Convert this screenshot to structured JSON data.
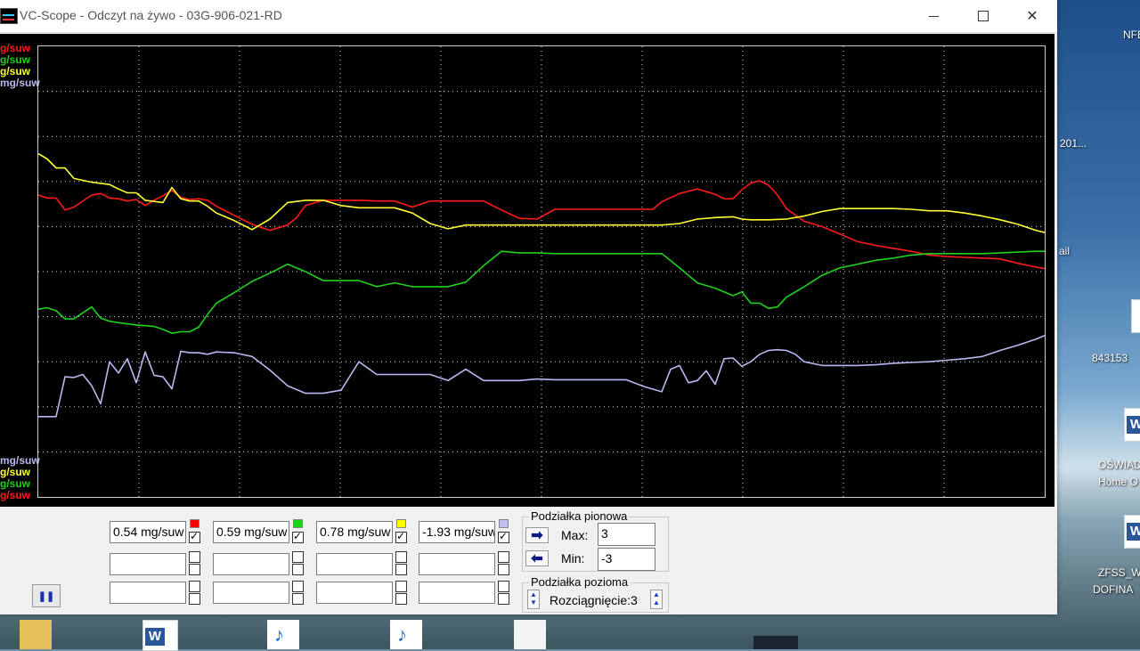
{
  "window": {
    "title": "VC-Scope  -  Odczyt na żywo  -  03G-906-021-RD"
  },
  "desktop": {
    "labels": {
      "nfe": "NFE",
      "d201": "201...",
      "ail": "ail",
      "num": "843153",
      "oswia": "OŚWIAD",
      "homeo": "Home O",
      "zfss": "ZFSS_W",
      "dofin": "DOFINA"
    }
  },
  "scope": {
    "top_labels": [
      "g/suw",
      "g/suw",
      "g/suw",
      "mg/suw"
    ],
    "bottom_labels": [
      "mg/suw",
      "g/suw",
      "g/suw",
      "g/suw"
    ],
    "colors": {
      "red": "#ff1a1a",
      "green": "#1fd11f",
      "yellow": "#ffff33",
      "lavender": "#b8b8f0",
      "grid": "#d8d8d8",
      "background": "#000000"
    },
    "grid": {
      "vertical_lines": 10,
      "horizontal_lines": 10,
      "style": "dotted"
    }
  },
  "chart_data": {
    "type": "line",
    "title": "",
    "xlabel": "",
    "ylabel": "",
    "ylim": [
      -3,
      3
    ],
    "series": [
      {
        "name": "",
        "color": "#ff1a1a",
        "x": [
          0,
          10,
          20,
          30,
          40,
          60,
          70,
          80,
          90,
          100,
          110,
          120,
          130,
          140,
          150,
          160,
          170,
          180,
          190,
          200,
          220,
          240,
          260,
          280,
          290,
          300,
          320,
          340,
          360,
          380,
          400,
          420,
          440,
          460,
          480,
          500,
          520,
          540,
          560,
          580,
          600,
          620,
          640,
          660,
          680,
          690,
          700,
          720,
          740,
          760,
          770,
          780,
          790,
          800,
          810,
          820,
          830,
          840,
          860,
          880,
          900,
          920,
          940,
          960,
          980,
          1000,
          1020,
          1040,
          1060,
          1080,
          1100,
          1120,
          1130
        ],
        "y": [
          1.02,
          0.98,
          0.98,
          0.82,
          0.86,
          1.02,
          1.04,
          0.98,
          0.97,
          0.94,
          0.96,
          0.88,
          0.95,
          1.01,
          1.08,
          0.99,
          0.96,
          0.97,
          0.95,
          0.87,
          0.75,
          0.63,
          0.55,
          0.62,
          0.72,
          0.88,
          0.95,
          0.95,
          0.95,
          0.94,
          0.94,
          0.86,
          0.94,
          0.94,
          0.94,
          0.94,
          0.82,
          0.71,
          0.7,
          0.83,
          0.83,
          0.83,
          0.83,
          0.83,
          0.83,
          0.83,
          0.93,
          1.04,
          1.1,
          1.03,
          0.97,
          0.97,
          1.09,
          1.18,
          1.21,
          1.15,
          1.02,
          0.84,
          0.67,
          0.6,
          0.5,
          0.4,
          0.35,
          0.31,
          0.27,
          0.22,
          0.2,
          0.19,
          0.18,
          0.17,
          0.11,
          0.06,
          0.04
        ]
      },
      {
        "name": "",
        "color": "#1fd11f",
        "x": [
          0,
          10,
          20,
          30,
          40,
          60,
          70,
          80,
          90,
          110,
          120,
          130,
          140,
          150,
          160,
          170,
          180,
          190,
          200,
          220,
          240,
          260,
          280,
          300,
          320,
          340,
          360,
          380,
          400,
          420,
          440,
          460,
          480,
          500,
          520,
          540,
          560,
          580,
          600,
          620,
          640,
          660,
          680,
          700,
          720,
          740,
          760,
          770,
          780,
          790,
          800,
          810,
          820,
          830,
          840,
          860,
          880,
          900,
          920,
          940,
          960,
          980,
          1000,
          1020,
          1040,
          1060,
          1080,
          1100,
          1120,
          1130
        ],
        "y": [
          -0.5,
          -0.48,
          -0.52,
          -0.63,
          -0.63,
          -0.47,
          -0.62,
          -0.66,
          -0.68,
          -0.71,
          -0.72,
          -0.73,
          -0.77,
          -0.82,
          -0.8,
          -0.8,
          -0.74,
          -0.57,
          -0.42,
          -0.28,
          -0.13,
          -0.02,
          0.1,
          0.0,
          -0.12,
          -0.12,
          -0.12,
          -0.2,
          -0.15,
          -0.2,
          -0.2,
          -0.2,
          -0.14,
          0.08,
          0.27,
          0.25,
          0.25,
          0.24,
          0.24,
          0.24,
          0.24,
          0.24,
          0.24,
          0.24,
          0.05,
          -0.15,
          -0.22,
          -0.27,
          -0.32,
          -0.27,
          -0.42,
          -0.42,
          -0.49,
          -0.47,
          -0.34,
          -0.2,
          -0.05,
          0.05,
          0.1,
          0.15,
          0.18,
          0.22,
          0.24,
          0.24,
          0.24,
          0.24,
          0.25,
          0.26,
          0.27,
          0.27
        ]
      },
      {
        "name": "",
        "color": "#ffff33",
        "x": [
          0,
          10,
          20,
          30,
          40,
          60,
          80,
          90,
          100,
          110,
          120,
          140,
          150,
          160,
          170,
          180,
          190,
          200,
          220,
          240,
          260,
          280,
          300,
          320,
          340,
          360,
          380,
          400,
          420,
          440,
          460,
          480,
          500,
          520,
          540,
          560,
          580,
          600,
          620,
          640,
          660,
          680,
          700,
          720,
          740,
          760,
          780,
          790,
          800,
          810,
          820,
          840,
          860,
          880,
          900,
          920,
          940,
          960,
          980,
          1000,
          1020,
          1040,
          1060,
          1080,
          1100,
          1120,
          1130
        ],
        "y": [
          1.57,
          1.5,
          1.38,
          1.38,
          1.24,
          1.19,
          1.16,
          1.1,
          1.05,
          1.05,
          0.95,
          0.92,
          1.12,
          0.97,
          0.94,
          0.94,
          0.87,
          0.78,
          0.68,
          0.56,
          0.7,
          0.92,
          0.95,
          0.95,
          0.88,
          0.85,
          0.85,
          0.85,
          0.78,
          0.64,
          0.57,
          0.62,
          0.62,
          0.62,
          0.62,
          0.62,
          0.62,
          0.62,
          0.62,
          0.62,
          0.62,
          0.62,
          0.62,
          0.64,
          0.7,
          0.72,
          0.73,
          0.7,
          0.69,
          0.69,
          0.69,
          0.7,
          0.74,
          0.8,
          0.84,
          0.84,
          0.84,
          0.84,
          0.83,
          0.81,
          0.81,
          0.78,
          0.74,
          0.69,
          0.63,
          0.55,
          0.52
        ]
      },
      {
        "name": "",
        "color": "#b8b8f0",
        "x": [
          0,
          10,
          20,
          30,
          40,
          50,
          60,
          70,
          80,
          90,
          100,
          110,
          120,
          130,
          140,
          150,
          160,
          170,
          180,
          190,
          200,
          220,
          240,
          260,
          280,
          300,
          320,
          340,
          360,
          380,
          400,
          420,
          440,
          460,
          480,
          500,
          520,
          540,
          560,
          580,
          600,
          620,
          640,
          660,
          680,
          700,
          710,
          720,
          730,
          740,
          750,
          760,
          770,
          780,
          790,
          800,
          810,
          820,
          830,
          840,
          850,
          860,
          880,
          900,
          920,
          940,
          960,
          980,
          1000,
          1020,
          1040,
          1060,
          1080,
          1100,
          1120,
          1130
        ],
        "y": [
          -1.93,
          -1.93,
          -1.93,
          -1.4,
          -1.41,
          -1.37,
          -1.52,
          -1.76,
          -1.2,
          -1.35,
          -1.16,
          -1.48,
          -1.07,
          -1.38,
          -1.4,
          -1.56,
          -1.06,
          -1.08,
          -1.08,
          -1.1,
          -1.07,
          -1.08,
          -1.13,
          -1.31,
          -1.52,
          -1.62,
          -1.62,
          -1.58,
          -1.2,
          -1.37,
          -1.37,
          -1.37,
          -1.37,
          -1.45,
          -1.3,
          -1.45,
          -1.45,
          -1.45,
          -1.43,
          -1.44,
          -1.44,
          -1.44,
          -1.44,
          -1.44,
          -1.53,
          -1.6,
          -1.3,
          -1.25,
          -1.48,
          -1.45,
          -1.32,
          -1.5,
          -1.16,
          -1.15,
          -1.26,
          -1.2,
          -1.1,
          -1.05,
          -1.04,
          -1.05,
          -1.1,
          -1.2,
          -1.25,
          -1.25,
          -1.25,
          -1.24,
          -1.22,
          -1.21,
          -1.2,
          -1.18,
          -1.16,
          -1.13,
          -1.05,
          -0.98,
          -0.9,
          -0.85
        ]
      }
    ]
  },
  "controls": {
    "values": [
      "0.54 mg/suw",
      "0.59 mg/suw",
      "0.78 mg/suw",
      "-1.93 mg/suw"
    ],
    "swatch_colors": [
      "#ff0000",
      "#1fd11f",
      "#ffff00",
      "#c0c0f0"
    ],
    "empty_rows": [
      "",
      "",
      "",
      "",
      "",
      "",
      "",
      ""
    ],
    "vertical_scale": {
      "title": "Podziałka pionowa",
      "max_label": "Max:",
      "max_value": "3",
      "min_label": "Min:",
      "min_value": "-3"
    },
    "horizontal_scale": {
      "title": "Podziałka pozioma",
      "stretch_label": "Rozciągnięcie:3"
    },
    "pause_label": "❚❚"
  }
}
